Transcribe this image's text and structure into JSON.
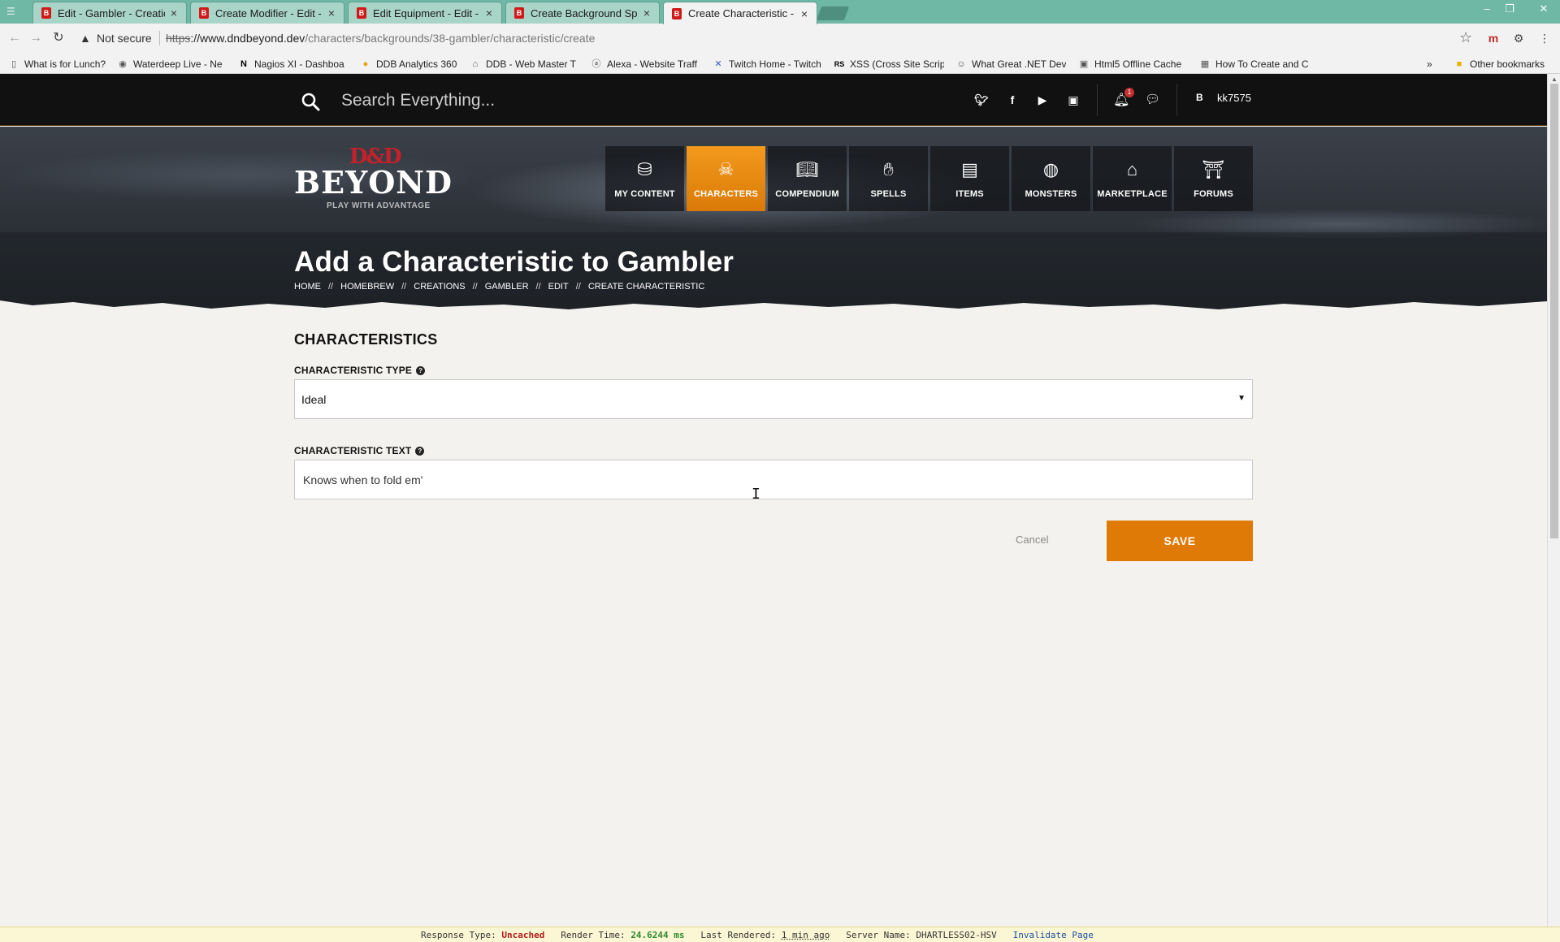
{
  "browser": {
    "tabs": [
      {
        "title": "Edit - Gambler - Creation",
        "active": false
      },
      {
        "title": "Create Modifier - Edit - C",
        "active": false
      },
      {
        "title": "Edit Equipment - Edit - C",
        "active": false
      },
      {
        "title": "Create Background Spec",
        "active": false
      },
      {
        "title": "Create Characteristic - Ec",
        "active": true
      }
    ],
    "security_label": "Not secure",
    "url_scheme": "https",
    "url_host": "://www.dndbeyond.dev",
    "url_path": "/characters/backgrounds/38-gambler/characteristic/create",
    "bookmarks": [
      "What is for Lunch?",
      "Waterdeep Live - Ne",
      "Nagios XI - Dashboa",
      "DDB Analytics 360",
      "DDB - Web Master T",
      "Alexa - Website Traff",
      "Twitch Home - Twitch",
      "XSS (Cross Site Script",
      "What Great .NET Dev",
      "Html5 Offline Cache",
      "How To Create and C"
    ],
    "bookmarks_more": "»",
    "other_bookmarks": "Other bookmarks"
  },
  "site": {
    "search_placeholder": "Search Everything...",
    "notification_count": "1",
    "user_initial": "B",
    "username": "kk7575",
    "logo": {
      "mark": "D&D",
      "name": "BEYOND",
      "tagline": "PLAY WITH ADVANTAGE"
    },
    "nav": [
      {
        "label": "MY CONTENT",
        "icon": "bag-icon",
        "active": false
      },
      {
        "label": "CHARACTERS",
        "icon": "skull-crossbones-icon",
        "active": true
      },
      {
        "label": "COMPENDIUM",
        "icon": "book-icon",
        "active": false
      },
      {
        "label": "SPELLS",
        "icon": "hand-spell-icon",
        "active": false
      },
      {
        "label": "ITEMS",
        "icon": "chest-icon",
        "active": false
      },
      {
        "label": "MONSTERS",
        "icon": "monster-icon",
        "active": false
      },
      {
        "label": "MARKETPLACE",
        "icon": "store-icon",
        "active": false
      },
      {
        "label": "FORUMS",
        "icon": "forum-pillar-icon",
        "active": false
      }
    ]
  },
  "page": {
    "title": "Add a Characteristic to Gambler",
    "breadcrumb": [
      "HOME",
      "HOMEBREW",
      "CREATIONS",
      "GAMBLER",
      "EDIT",
      "CREATE CHARACTERISTIC"
    ],
    "breadcrumb_sep": "//"
  },
  "form": {
    "section_title": "CHARACTERISTICS",
    "type_label": "CHARACTERISTIC TYPE",
    "type_value": "Ideal",
    "text_label": "CHARACTERISTIC TEXT",
    "text_value": "Knows when to fold em'",
    "cancel_label": "Cancel",
    "save_label": "SAVE"
  },
  "debug": {
    "response_type_label": "Response Type:",
    "response_type_value": "Uncached",
    "render_time_label": "Render Time:",
    "render_time_value": "24.6244 ms",
    "last_rendered_label": "Last Rendered:",
    "last_rendered_value": "1 min ago",
    "server_name_label": "Server Name:",
    "server_name_value": "DHARTLESS02-HSV",
    "invalidate_label": "Invalidate Page"
  },
  "colors": {
    "accent": "#e07a06",
    "tabbar": "#6eb8a5",
    "header": "#111111"
  }
}
